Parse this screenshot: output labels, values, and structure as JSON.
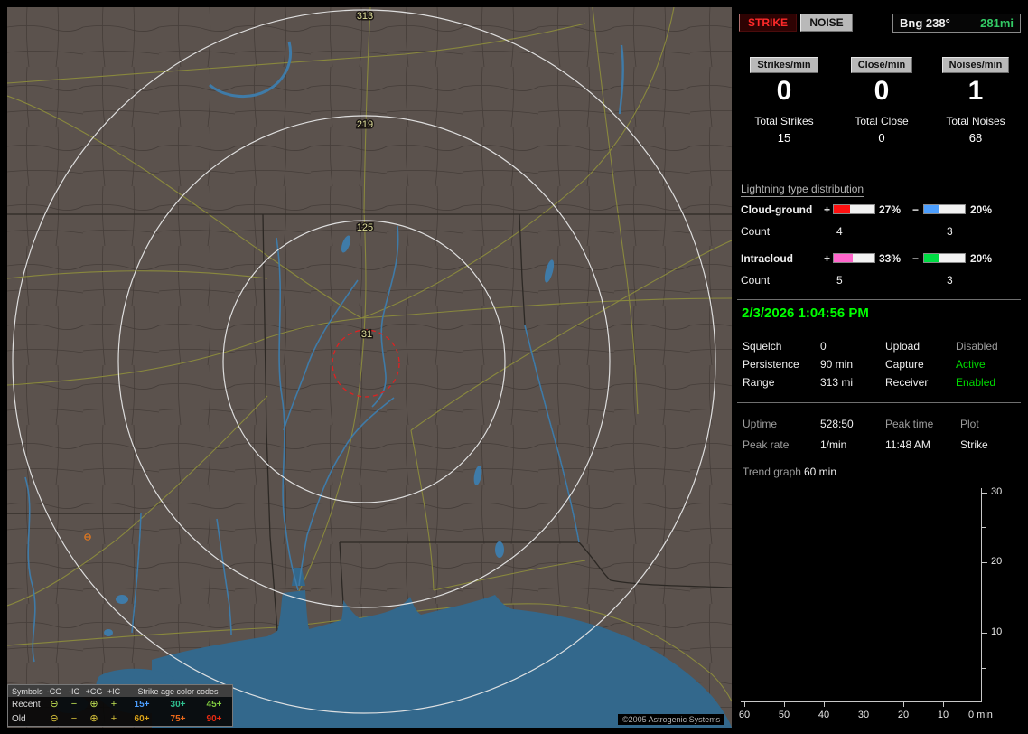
{
  "window": {
    "copyright": "©2005 Astrogenic Systems"
  },
  "map": {
    "rings": [
      {
        "label": "313"
      },
      {
        "label": "219"
      },
      {
        "label": "125"
      },
      {
        "label": "31"
      }
    ],
    "legend": {
      "symbols_label": "Symbols",
      "headers": [
        "-CG",
        "-IC",
        "+CG",
        "+IC"
      ],
      "age_header": "Strike age color codes",
      "recent_label": "Recent",
      "old_label": "Old",
      "symbols": [
        "⊖",
        "−",
        "⊕",
        "+"
      ],
      "recent_ages": [
        "15+",
        "30+",
        "45+"
      ],
      "old_ages": [
        "60+",
        "75+",
        "90+"
      ]
    }
  },
  "panel": {
    "strike_button": "STRIKE",
    "noise_button": "NOISE",
    "bearing": {
      "label": "Bng 238°",
      "distance": "281mi"
    },
    "rates": [
      {
        "label": "Strikes/min",
        "value": "0",
        "total_label": "Total Strikes",
        "total": "15"
      },
      {
        "label": "Close/min",
        "value": "0",
        "total_label": "Total Close",
        "total": "0"
      },
      {
        "label": "Noises/min",
        "value": "1",
        "total_label": "Total Noises",
        "total": "68"
      }
    ],
    "distribution": {
      "title": "Lightning type distribution",
      "plus": "+",
      "minus": "−",
      "count_label": "Count",
      "rows": [
        {
          "label": "Cloud-ground",
          "plus_pct": "27%",
          "minus_pct": "20%",
          "plus_count": "4",
          "minus_count": "3"
        },
        {
          "label": "Intracloud",
          "plus_pct": "33%",
          "minus_pct": "20%",
          "plus_count": "5",
          "minus_count": "3"
        }
      ]
    },
    "clock": "2/3/2026 1:04:56 PM",
    "settings": {
      "squelch_label": "Squelch",
      "squelch": "0",
      "persistence_label": "Persistence",
      "persistence": "90 min",
      "range_label": "Range",
      "range": "313 mi",
      "upload_label": "Upload",
      "upload": "Disabled",
      "capture_label": "Capture",
      "capture": "Active",
      "receiver_label": "Receiver",
      "receiver": "Enabled"
    },
    "status": {
      "uptime_label": "Uptime",
      "uptime": "528:50",
      "peak_time_label": "Peak time",
      "peak_time": "11:48 AM",
      "peak_rate_label": "Peak rate",
      "peak_rate": "1/min",
      "plot_label": "Plot",
      "plot": "Strike",
      "trend_label": "Trend graph",
      "trend_value": "60 min"
    },
    "trend_chart": {
      "y_ticks": [
        "30",
        "20",
        "10"
      ],
      "x_ticks": [
        "60",
        "50",
        "40",
        "30",
        "20",
        "10",
        "0 min"
      ]
    }
  },
  "colors": {
    "cg_plus": "#ff1111",
    "cg_minus": "#4d9fff",
    "ic_plus": "#ff66cc",
    "ic_minus": "#00dd44",
    "clock_green": "#00ff00",
    "active_green": "#00dd00",
    "bearing_green": "#33cc66",
    "disabled_gray": "#9a9a9a",
    "age_15": "#4d9fff",
    "age_30": "#2fbf8f",
    "age_45": "#7fc93f",
    "age_60": "#d6a118",
    "age_75": "#e8681a",
    "age_90": "#e82a12",
    "land": "#5b524d",
    "water": "#33688c",
    "road": "#8e8e3c",
    "range_ring": "#e6e6e6",
    "close_ring": "#dd2222",
    "ring_label": "#dede9a"
  }
}
